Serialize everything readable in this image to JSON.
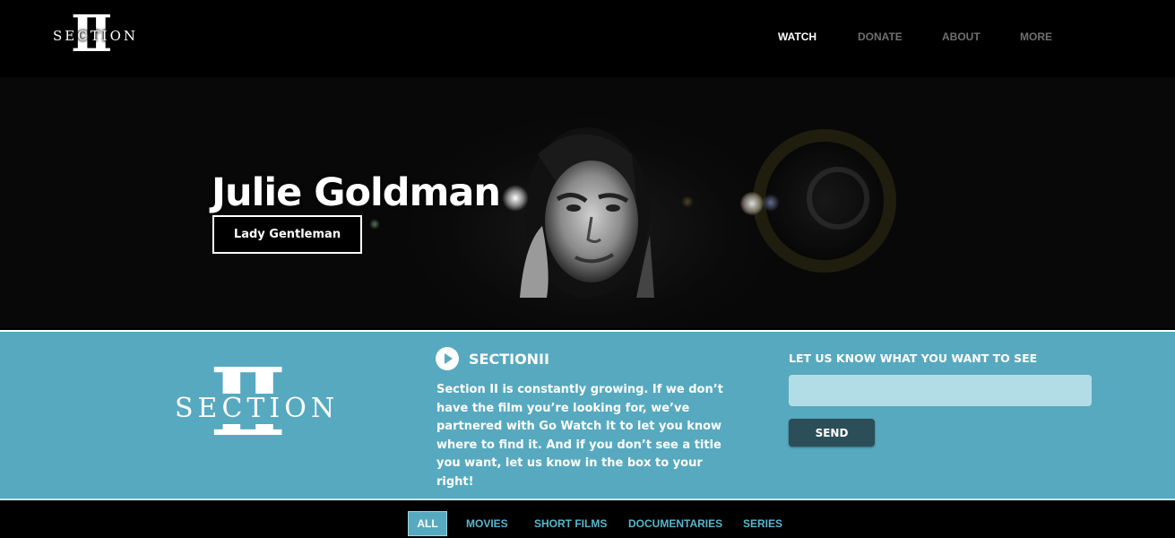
{
  "brand": {
    "logo_text": "SECTION",
    "logo_numeral": "II"
  },
  "nav": {
    "items": [
      {
        "label": "WATCH",
        "active": true
      },
      {
        "label": "DONATE",
        "active": false
      },
      {
        "label": "ABOUT",
        "active": false
      },
      {
        "label": "MORE",
        "active": false
      }
    ]
  },
  "hero": {
    "title": "Julie Goldman",
    "button_label": "Lady Gentleman"
  },
  "about": {
    "title": "SECTIONII",
    "body": "Section II is constantly growing. If we don’t have the film you’re looking for, we’ve partnered with Go Watch It to let you know where to find it. And if you don’t see a title you want, let us know in the box to your right!"
  },
  "request": {
    "label": "LET US KNOW WHAT YOU WANT TO SEE",
    "value": "",
    "button_label": "SEND"
  },
  "filters": {
    "items": [
      {
        "label": "ALL",
        "active": true
      },
      {
        "label": "MOVIES",
        "active": false
      },
      {
        "label": "SHORT FILMS",
        "active": false
      },
      {
        "label": "DOCUMENTARIES",
        "active": false
      },
      {
        "label": "SERIES",
        "active": false
      }
    ]
  },
  "colors": {
    "accent": "#57a9bf",
    "send_button": "#2b4e58",
    "input_bg": "#b3dde6"
  }
}
